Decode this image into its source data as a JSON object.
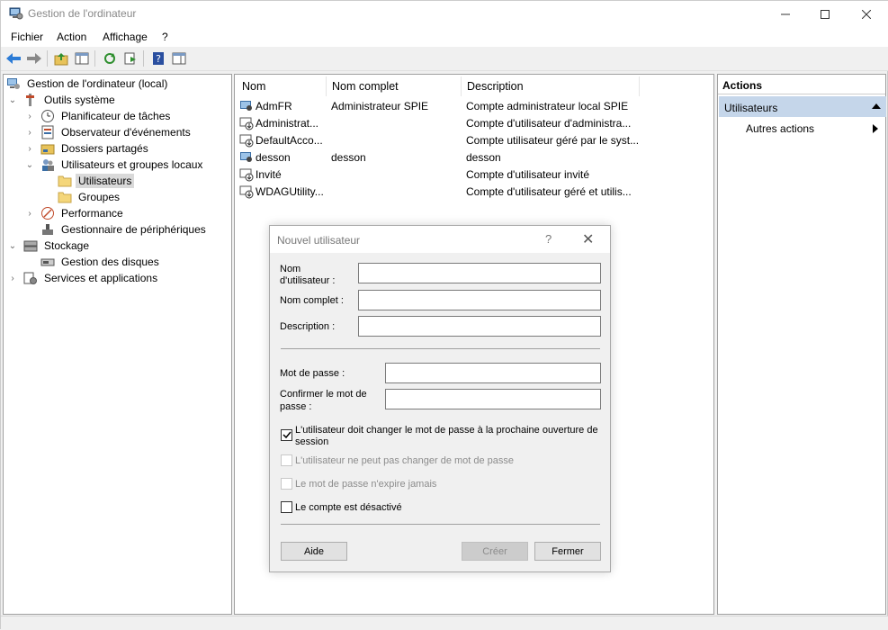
{
  "window": {
    "title": "Gestion de l'ordinateur"
  },
  "menu": [
    "Fichier",
    "Action",
    "Affichage",
    "?"
  ],
  "tree": {
    "root": "Gestion de l'ordinateur (local)",
    "outils": "Outils système",
    "planificateur": "Planificateur de tâches",
    "observateur": "Observateur d'événements",
    "dossiers": "Dossiers partagés",
    "utilisateurs_groupes": "Utilisateurs et groupes locaux",
    "utilisateurs": "Utilisateurs",
    "groupes": "Groupes",
    "performance": "Performance",
    "gestionnaire": "Gestionnaire de périphériques",
    "stockage": "Stockage",
    "gestion_disques": "Gestion des disques",
    "services": "Services et applications"
  },
  "list": {
    "headers": {
      "nom": "Nom",
      "nom_complet": "Nom complet",
      "description": "Description"
    },
    "rows": [
      {
        "nom": "AdmFR",
        "nom_complet": "Administrateur SPIE",
        "description": "Compte administrateur local SPIE"
      },
      {
        "nom": "Administrat...",
        "nom_complet": "",
        "description": "Compte d'utilisateur d'administra..."
      },
      {
        "nom": "DefaultAcco...",
        "nom_complet": "",
        "description": "Compte utilisateur géré par le syst..."
      },
      {
        "nom": "desson",
        "nom_complet": "desson",
        "description": "desson"
      },
      {
        "nom": "Invité",
        "nom_complet": "",
        "description": "Compte d'utilisateur invité"
      },
      {
        "nom": "WDAGUtility...",
        "nom_complet": "",
        "description": "Compte d'utilisateur géré et utilis..."
      }
    ]
  },
  "actions": {
    "title": "Actions",
    "group": "Utilisateurs",
    "item": "Autres actions"
  },
  "dialog": {
    "title": "Nouvel utilisateur",
    "help": "?",
    "nom_label_1": "Nom",
    "nom_label_2": "d'utilisateur :",
    "nom_complet_label": "Nom complet :",
    "description_label": "Description :",
    "mdp_label": "Mot de passe :",
    "confirmer_label_1": "Confirmer le mot de",
    "confirmer_label_2": "passe :",
    "nom_value": "",
    "nom_complet_value": "",
    "description_value": "",
    "mdp_value": "",
    "confirmer_value": "",
    "chk_changer_1": "L'utilisateur doit changer le mot de passe à la prochaine ouverture de",
    "chk_changer_2": "session",
    "chk_ne_peut_pas": "L'utilisateur ne peut pas changer de mot de passe",
    "chk_expire": "Le mot de passe n'expire jamais",
    "chk_desactive": "Le compte est désactivé",
    "btn_aide": "Aide",
    "btn_creer": "Créer",
    "btn_fermer": "Fermer"
  }
}
